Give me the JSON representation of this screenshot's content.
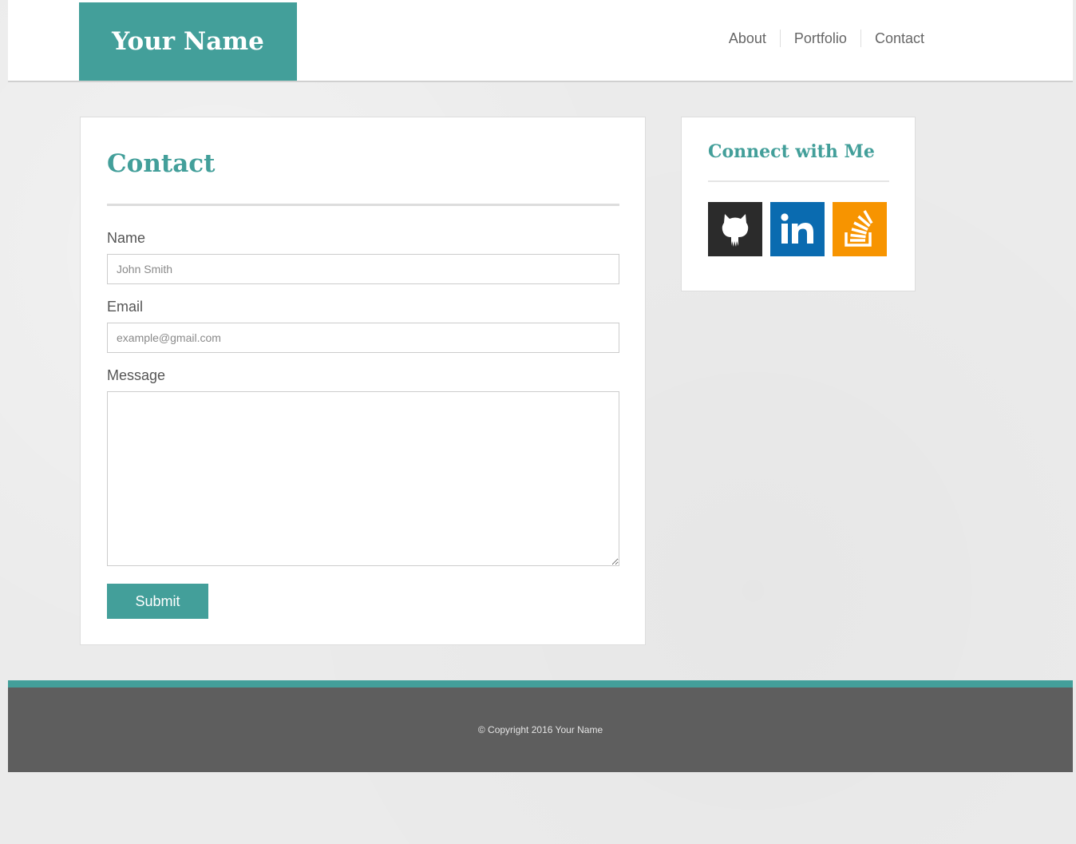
{
  "header": {
    "brand": "Your Name",
    "nav": [
      {
        "label": "About"
      },
      {
        "label": "Portfolio"
      },
      {
        "label": "Contact"
      }
    ]
  },
  "contact": {
    "title": "Contact",
    "name_label": "Name",
    "name_placeholder": "John Smith",
    "email_label": "Email",
    "email_placeholder": "example@gmail.com",
    "message_label": "Message",
    "submit_label": "Submit"
  },
  "connect": {
    "title": "Connect with Me",
    "icons": {
      "github": "github-icon",
      "linkedin": "linkedin-icon",
      "stackoverflow": "stackoverflow-icon"
    }
  },
  "footer": {
    "copyright": "© Copyright 2016 Your Name"
  },
  "colors": {
    "accent": "#439f9a",
    "footer_bg": "#5e5e5e",
    "github_bg": "#2b2b2b",
    "linkedin_bg": "#0a6bb0",
    "stackoverflow_bg": "#f79400"
  }
}
